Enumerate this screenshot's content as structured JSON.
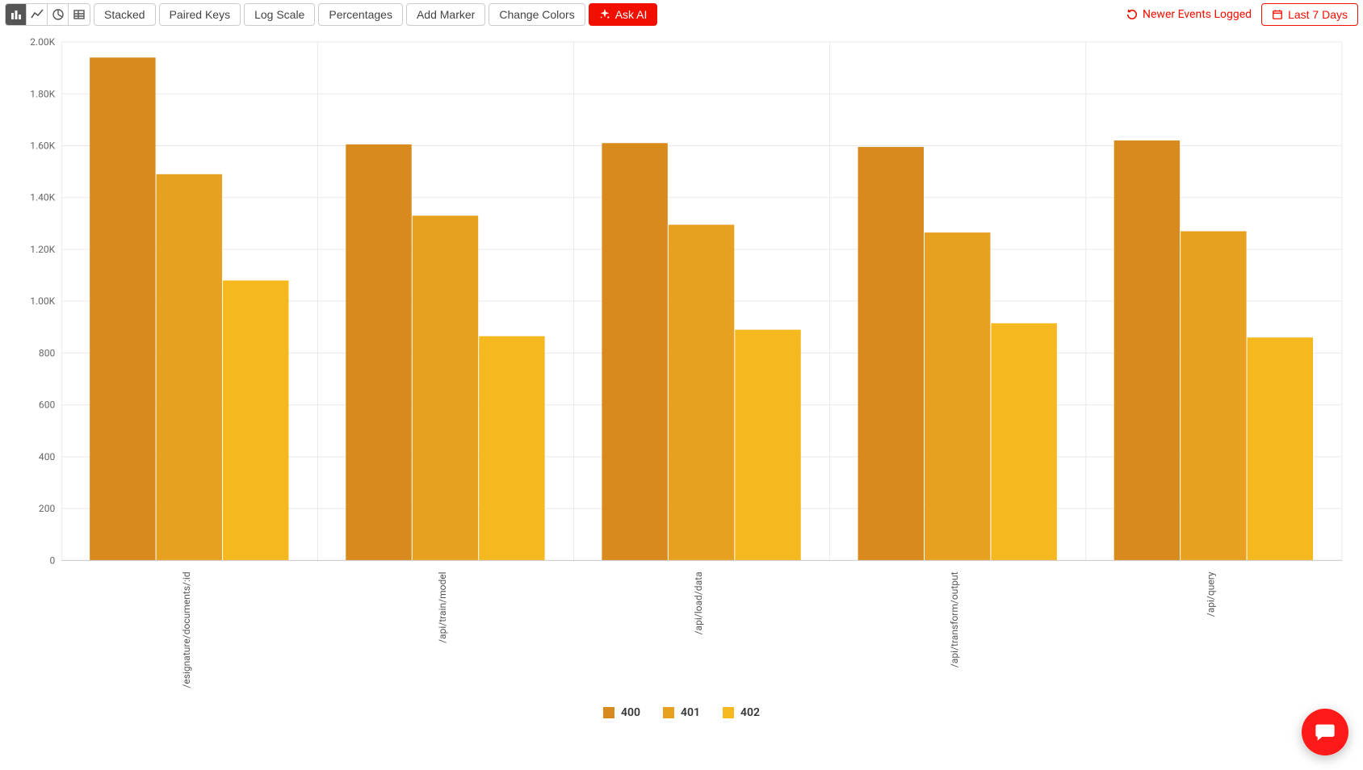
{
  "toolbar": {
    "buttons": {
      "stacked": "Stacked",
      "paired_keys": "Paired Keys",
      "log_scale": "Log Scale",
      "percentages": "Percentages",
      "add_marker": "Add Marker",
      "change_colors": "Change Colors",
      "ask_ai": "Ask AI"
    },
    "right": {
      "newer_events": "Newer Events Logged",
      "date_range": "Last 7 Days"
    },
    "chart_type_icons": [
      "bar",
      "line",
      "pie",
      "table"
    ],
    "active_chart_icon": "bar"
  },
  "legend": {
    "items": [
      {
        "name": "400",
        "color": "#D98A1D"
      },
      {
        "name": "401",
        "color": "#E8A021"
      },
      {
        "name": "402",
        "color": "#F5B91F"
      }
    ]
  },
  "chart_data": {
    "type": "bar",
    "title": "",
    "xlabel": "",
    "ylabel": "",
    "ylim": [
      0,
      2000
    ],
    "y_ticks": [
      0,
      200,
      400,
      600,
      800,
      1000,
      1200,
      1400,
      1600,
      1800,
      2000
    ],
    "y_tick_labels": [
      "0",
      "200",
      "400",
      "600",
      "800",
      "1.00K",
      "1.20K",
      "1.40K",
      "1.60K",
      "1.80K",
      "2.00K"
    ],
    "categories": [
      "/esignature/documents/:id",
      "/api/train/model",
      "/api/load/data",
      "/api/transform/output",
      "/api/query"
    ],
    "series": [
      {
        "name": "400",
        "color": "#D98A1D",
        "values": [
          1940,
          1605,
          1610,
          1595,
          1620
        ]
      },
      {
        "name": "401",
        "color": "#E8A021",
        "values": [
          1490,
          1330,
          1295,
          1265,
          1270
        ]
      },
      {
        "name": "402",
        "color": "#F5B91F",
        "values": [
          1080,
          865,
          890,
          915,
          860
        ]
      }
    ]
  }
}
